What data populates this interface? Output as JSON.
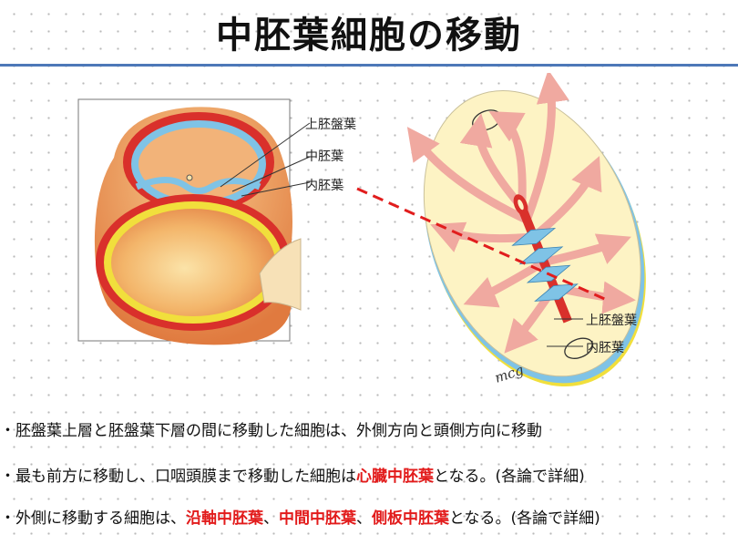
{
  "title": "中胚葉細胞の移動",
  "figure": {
    "left_labels": [
      "上胚盤葉",
      "中胚葉",
      "内胚葉"
    ],
    "right_labels": [
      "上胚盤葉",
      "内胚葉"
    ],
    "signature": "mcg"
  },
  "bullets": [
    {
      "marker": "・",
      "parts": [
        {
          "text": "胚盤葉上層と胚盤葉下層の間に移動した細胞は、外側方向と頭側方向に移動",
          "highlight": false
        }
      ]
    },
    {
      "marker": "・",
      "parts": [
        {
          "text": "最も前方に移動し、口咽頭膜まで移動した細胞は",
          "highlight": false
        },
        {
          "text": "心臓中胚葉",
          "highlight": true
        },
        {
          "text": "となる。(各論で詳細)",
          "highlight": false
        }
      ]
    },
    {
      "marker": "・",
      "parts": [
        {
          "text": "外側に移動する細胞は、",
          "highlight": false
        },
        {
          "text": "沿軸中胚葉",
          "highlight": true
        },
        {
          "text": "、",
          "highlight": false
        },
        {
          "text": "中間中胚葉",
          "highlight": true
        },
        {
          "text": "、",
          "highlight": false
        },
        {
          "text": "側板中胚葉",
          "highlight": true
        },
        {
          "text": "となる。(各論で詳細)",
          "highlight": false
        }
      ]
    }
  ],
  "colors": {
    "highlight": "#e21b1b",
    "rule": "#4d78b8",
    "ectoderm": "#7fc3e6",
    "endoderm": "#f1df3c",
    "mesoderm": "#d9302b"
  }
}
